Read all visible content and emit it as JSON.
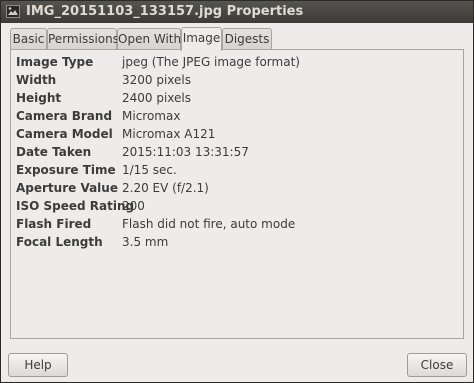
{
  "window": {
    "title": "IMG_20151103_133157.jpg Properties"
  },
  "tabs": [
    {
      "label": "Basic",
      "active": false
    },
    {
      "label": "Permissions",
      "active": false
    },
    {
      "label": "Open With",
      "active": false
    },
    {
      "label": "Image",
      "active": true
    },
    {
      "label": "Digests",
      "active": false
    }
  ],
  "image_info": [
    {
      "label": "Image Type",
      "value": "jpeg (The JPEG image format)"
    },
    {
      "label": "Width",
      "value": "3200 pixels"
    },
    {
      "label": "Height",
      "value": "2400 pixels"
    },
    {
      "label": "Camera Brand",
      "value": "Micromax"
    },
    {
      "label": "Camera Model",
      "value": "Micromax A121"
    },
    {
      "label": "Date Taken",
      "value": "2015:11:03 13:31:57"
    },
    {
      "label": "Exposure Time",
      "value": "1/15 sec."
    },
    {
      "label": "Aperture Value",
      "value": "2.20 EV (f/2.1)"
    },
    {
      "label": "ISO Speed Rating",
      "value": "200"
    },
    {
      "label": "Flash Fired",
      "value": "Flash did not fire, auto mode"
    },
    {
      "label": "Focal Length",
      "value": "3.5 mm"
    }
  ],
  "buttons": {
    "help_label": "Help",
    "close_label": "Close"
  },
  "icons": {
    "app": "image-file-icon"
  }
}
